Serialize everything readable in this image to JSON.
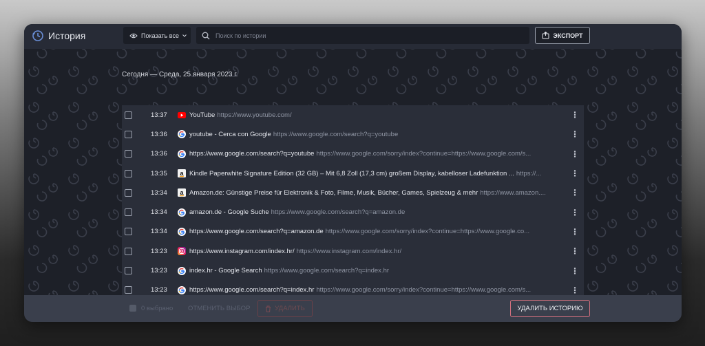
{
  "header": {
    "title": "История",
    "show_dropdown": "Показать все",
    "search_placeholder": "Поиск по истории",
    "export_label": "ЭКСПОРТ"
  },
  "date_heading": "Сегодня — Среда, 25 января 2023 г.",
  "rows": [
    {
      "time": "13:37",
      "icon": "youtube-icon",
      "title": "YouTube",
      "url": "https://www.youtube.com/"
    },
    {
      "time": "13:36",
      "icon": "google-icon",
      "title": "youtube - Cerca con Google",
      "url": "https://www.google.com/search?q=youtube"
    },
    {
      "time": "13:36",
      "icon": "google-icon",
      "title": "https://www.google.com/search?q=youtube",
      "url": "https://www.google.com/sorry/index?continue=https://www.google.com/s..."
    },
    {
      "time": "13:35",
      "icon": "amazon-icon",
      "title": "Kindle Paperwhite Signature Edition (32 GB) – Mit 6,8 Zoll (17,3 cm) großem Display, kabelloser Ladefunktion ...",
      "url": "https://..."
    },
    {
      "time": "13:34",
      "icon": "amazon-icon",
      "title": "Amazon.de: Günstige Preise für Elektronik & Foto, Filme, Musik, Bücher, Games, Spielzeug & mehr",
      "url": "https://www.amazon...."
    },
    {
      "time": "13:34",
      "icon": "google-icon",
      "title": "amazon.de - Google Suche",
      "url": "https://www.google.com/search?q=amazon.de"
    },
    {
      "time": "13:34",
      "icon": "google-icon",
      "title": "https://www.google.com/search?q=amazon.de",
      "url": "https://www.google.com/sorry/index?continue=https://www.google.co..."
    },
    {
      "time": "13:23",
      "icon": "instagram-icon",
      "title": "https://www.instagram.com/index.hr/",
      "url": "https://www.instagram.com/index.hr/"
    },
    {
      "time": "13:23",
      "icon": "google-icon",
      "title": "index.hr - Google Search",
      "url": "https://www.google.com/search?q=index.hr"
    },
    {
      "time": "13:23",
      "icon": "google-icon",
      "title": "https://www.google.com/search?q=index.hr",
      "url": "https://www.google.com/sorry/index?continue=https://www.google.com/s..."
    }
  ],
  "footer": {
    "selected_count": "0 выбрано",
    "cancel_selection": "ОТМЕНИТЬ ВЫБОР",
    "delete_label": "УДАЛИТЬ",
    "clear_history": "УДАЛИТЬ ИСТОРИЮ"
  },
  "colors": {
    "background": "#1d2028",
    "header": "#272b36",
    "list": "#2a2e39",
    "footer": "#3a3f4c",
    "accent_border": "#d3707e"
  }
}
